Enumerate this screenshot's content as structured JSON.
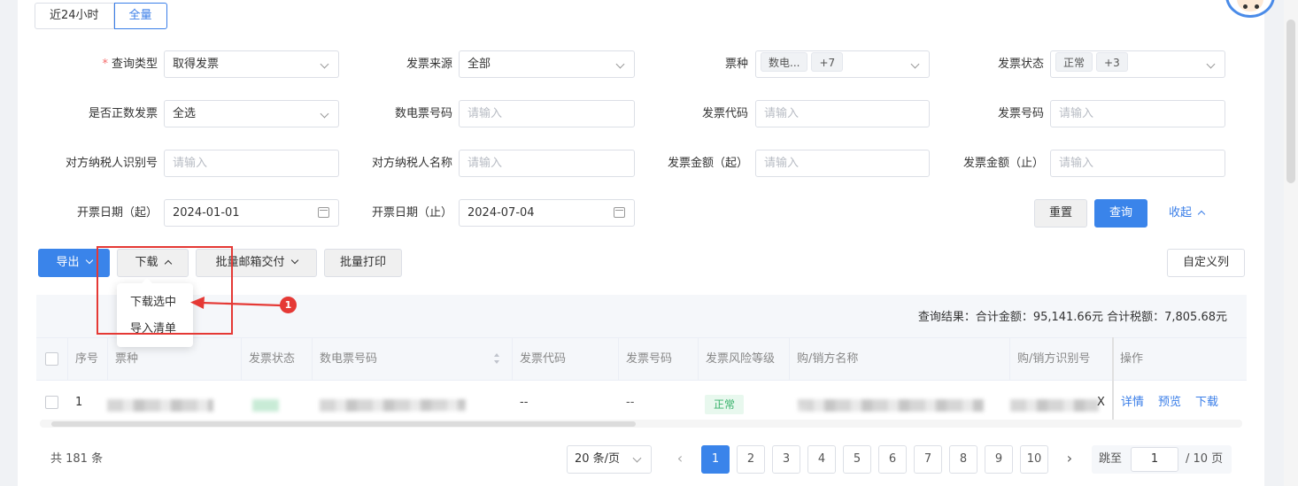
{
  "tabs": [
    {
      "label": "近24小时",
      "active": false
    },
    {
      "label": "全量",
      "active": true
    }
  ],
  "filters": {
    "query_type": {
      "label": "查询类型",
      "value": "取得发票"
    },
    "invoice_source": {
      "label": "发票来源",
      "value": "全部"
    },
    "ticket_type": {
      "label": "票种",
      "tag": "数电...",
      "more": "+7"
    },
    "invoice_status": {
      "label": "发票状态",
      "tag": "正常",
      "more": "+3"
    },
    "is_positive": {
      "label": "是否正数发票",
      "value": "全选"
    },
    "digital_number": {
      "label": "数电票号码",
      "placeholder": "请输入"
    },
    "invoice_code": {
      "label": "发票代码",
      "placeholder": "请输入"
    },
    "invoice_number": {
      "label": "发票号码",
      "placeholder": "请输入"
    },
    "counterparty_id": {
      "label": "对方纳税人识别号",
      "placeholder": "请输入"
    },
    "counterparty_name": {
      "label": "对方纳税人名称",
      "placeholder": "请输入"
    },
    "amount_from": {
      "label": "发票金额（起）",
      "placeholder": "请输入"
    },
    "amount_to": {
      "label": "发票金额（止）",
      "placeholder": "请输入"
    },
    "date_from": {
      "label": "开票日期（起）",
      "value": "2024-01-01"
    },
    "date_to": {
      "label": "开票日期（止）",
      "value": "2024-07-04"
    }
  },
  "actions": {
    "reset": "重置",
    "search": "查询",
    "collapse": "收起"
  },
  "toolbar": {
    "export": "导出",
    "download": "下载",
    "batch_mail": "批量邮箱交付",
    "batch_print": "批量打印",
    "custom_columns": "自定义列"
  },
  "download_menu": [
    "下载选中",
    "导入清单"
  ],
  "annotation": {
    "step": "1"
  },
  "summary": "查询结果：合计金额：95,141.66元   合计税额：7,805.68元",
  "table": {
    "headers": [
      "序号",
      "票种",
      "发票状态",
      "数电票号码",
      "发票代码",
      "发票号码",
      "发票风险等级",
      "购/销方名称",
      "购/销方识别号",
      "操作"
    ],
    "row": {
      "index": "1",
      "invoice_code": "--",
      "invoice_number": "--",
      "risk": "正常",
      "id_tail": "X",
      "ops": [
        "详情",
        "预览",
        "下载"
      ]
    }
  },
  "pagination": {
    "total": "共 181 条",
    "page_size": "20 条/页",
    "pages": [
      "1",
      "2",
      "3",
      "4",
      "5",
      "6",
      "7",
      "8",
      "9",
      "10"
    ],
    "current": "1",
    "jump_label": "跳至",
    "jump_value": "1",
    "jump_suffix": "/ 10 页"
  },
  "colors": {
    "primary": "#3a84ea",
    "annotation": "#e53935"
  }
}
